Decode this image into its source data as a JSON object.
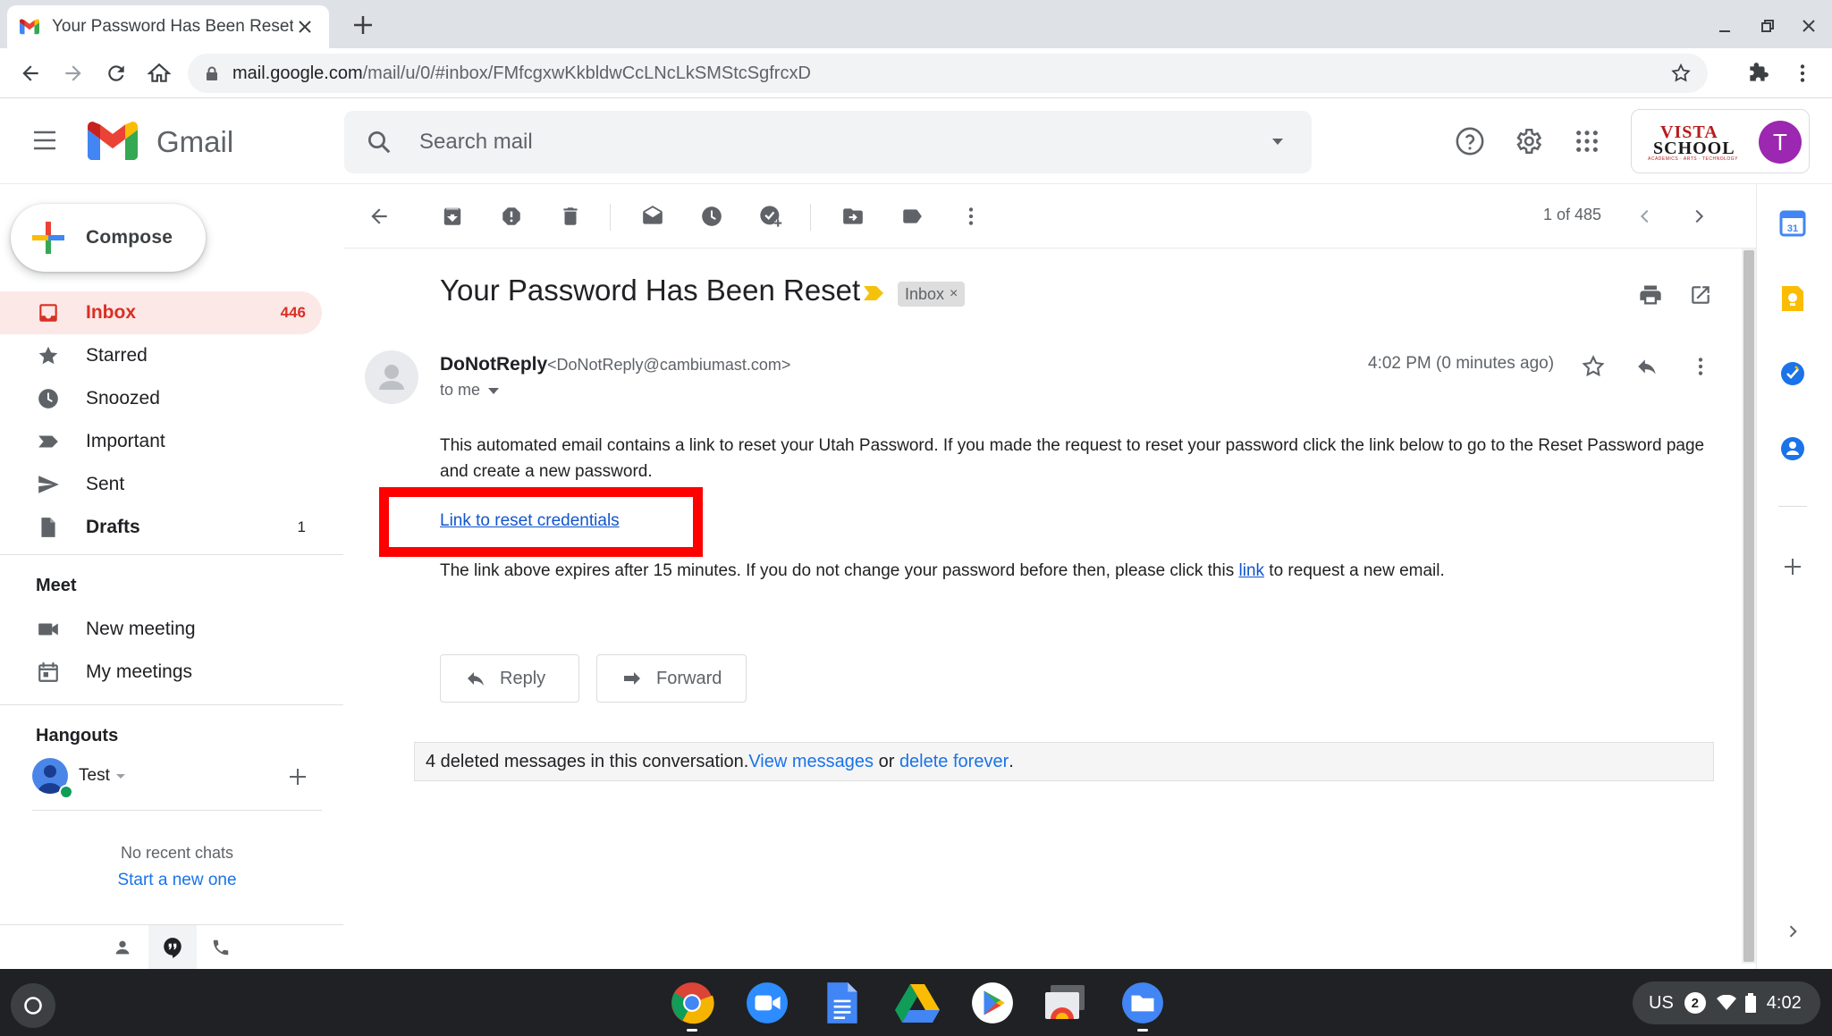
{
  "browser": {
    "tab_title": "Your Password Has Been Reset -",
    "url_host": "mail.google.com",
    "url_path": "/mail/u/0/#inbox/FMfcgxwKkbldwCcLNcLkSMStcSgfrcxD"
  },
  "header": {
    "app_name": "Gmail",
    "search_placeholder": "Search mail",
    "account_initial": "T",
    "org_logo_line1": "VISTA",
    "org_logo_line2": "SCHOOL",
    "org_logo_tagline": "ACADEMICS · ARTS · TECHNOLOGY"
  },
  "sidebar": {
    "compose_label": "Compose",
    "items": [
      {
        "label": "Inbox",
        "count": "446",
        "icon": "inbox-icon",
        "active": true
      },
      {
        "label": "Starred",
        "count": "",
        "icon": "star-icon"
      },
      {
        "label": "Snoozed",
        "count": "",
        "icon": "clock-icon"
      },
      {
        "label": "Important",
        "count": "",
        "icon": "important-icon"
      },
      {
        "label": "Sent",
        "count": "",
        "icon": "send-icon"
      },
      {
        "label": "Drafts",
        "count": "1",
        "icon": "draft-icon"
      }
    ],
    "meet": {
      "title": "Meet",
      "new_meeting": "New meeting",
      "my_meetings": "My meetings"
    },
    "hangouts": {
      "title": "Hangouts",
      "user": "Test",
      "no_chats": "No recent chats",
      "start_new": "Start a new one"
    }
  },
  "toolbar": {
    "pager": "1 of 485"
  },
  "message": {
    "subject": "Your Password Has Been Reset",
    "label": "Inbox",
    "sender_name": "DoNotReply",
    "sender_email": "<DoNotReply@cambiumast.com>",
    "to": "to me",
    "time": "4:02 PM (0 minutes ago)",
    "body_p1": "This automated email contains a link to reset your Utah Password. If you made the request to reset your password click the link below to go to the Reset Password page and create a new password.",
    "reset_link": "Link to reset credentials",
    "body_p2_before": "The link above expires after 15 minutes. If you do not change your password before then, please click this ",
    "body_p2_link": "link",
    "body_p2_after": " to request a new email.",
    "reply_label": "Reply",
    "forward_label": "Forward",
    "deleted_text": "4 deleted messages in this conversation. ",
    "view_messages": "View messages",
    "or_text": " or ",
    "delete_forever": "delete forever",
    "period": "."
  },
  "shelf": {
    "locale": "US",
    "notif_count": "2",
    "clock": "4:02"
  },
  "colors": {
    "gmail_red": "#d93025",
    "link_blue": "#1155cc",
    "highlight_box": "#ff0000",
    "avatar_purple": "#9c27b0"
  }
}
